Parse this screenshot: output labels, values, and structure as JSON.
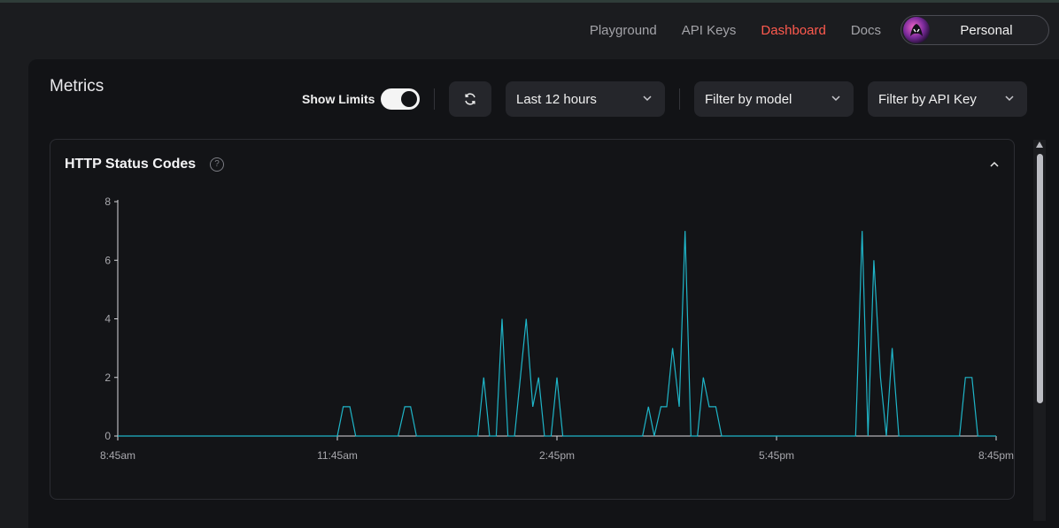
{
  "nav": {
    "links": [
      {
        "label": "Playground",
        "active": false
      },
      {
        "label": "API Keys",
        "active": false
      },
      {
        "label": "Dashboard",
        "active": true
      },
      {
        "label": "Docs",
        "active": false
      }
    ],
    "account_label": "Personal"
  },
  "page": {
    "title": "Metrics"
  },
  "toolbar": {
    "show_limits_label": "Show Limits",
    "show_limits_on": true,
    "time_range": "Last 12 hours",
    "model_filter": "Filter by model",
    "api_key_filter": "Filter by API Key"
  },
  "card": {
    "title": "HTTP Status Codes",
    "help_glyph": "?"
  },
  "colors": {
    "accent": "#ff5a4e",
    "series": "#1fb5c8",
    "axis": "#d8d8dc"
  },
  "chart_data": {
    "type": "line",
    "title": "HTTP Status Codes",
    "xlabel": "",
    "ylabel": "",
    "x_ticks": [
      "8:45am",
      "11:45am",
      "2:45pm",
      "5:45pm",
      "8:45pm"
    ],
    "x_tick_hours": [
      8.75,
      11.75,
      14.75,
      17.75,
      20.75
    ],
    "y_ticks": [
      "0",
      "2",
      "4",
      "6",
      "8"
    ],
    "ylim": [
      0,
      8
    ],
    "xlim_hours": [
      8.75,
      20.75
    ],
    "grid": false,
    "legend": "none",
    "series": [
      {
        "x_hours": [
          8.75,
          11.75,
          11.83,
          11.92,
          12.0,
          12.58,
          12.67,
          12.75,
          12.83,
          13.67,
          13.75,
          13.83,
          13.92,
          14.0,
          14.08,
          14.17,
          14.25,
          14.33,
          14.42,
          14.5,
          14.58,
          14.67,
          14.75,
          14.83,
          14.92,
          15.92,
          16.0,
          16.08,
          16.17,
          16.25,
          16.33,
          16.42,
          16.5,
          16.58,
          16.67,
          16.75,
          16.83,
          16.92,
          17.0,
          17.08,
          17.17,
          18.83,
          18.92,
          19.0,
          19.08,
          19.17,
          19.25,
          19.33,
          19.42,
          19.5,
          20.25,
          20.33,
          20.42,
          20.5,
          20.75
        ],
        "y": [
          0,
          0,
          1,
          1,
          0,
          0,
          1,
          1,
          0,
          0,
          2,
          0,
          0,
          4,
          0,
          0,
          2,
          4,
          1,
          2,
          0,
          0,
          2,
          0,
          0,
          0,
          1,
          0,
          1,
          1,
          3,
          1,
          7,
          0,
          0,
          2,
          1,
          1,
          0,
          0,
          0,
          0,
          7,
          0,
          6,
          2,
          0,
          3,
          0,
          0,
          0,
          2,
          2,
          0,
          0
        ]
      }
    ]
  }
}
